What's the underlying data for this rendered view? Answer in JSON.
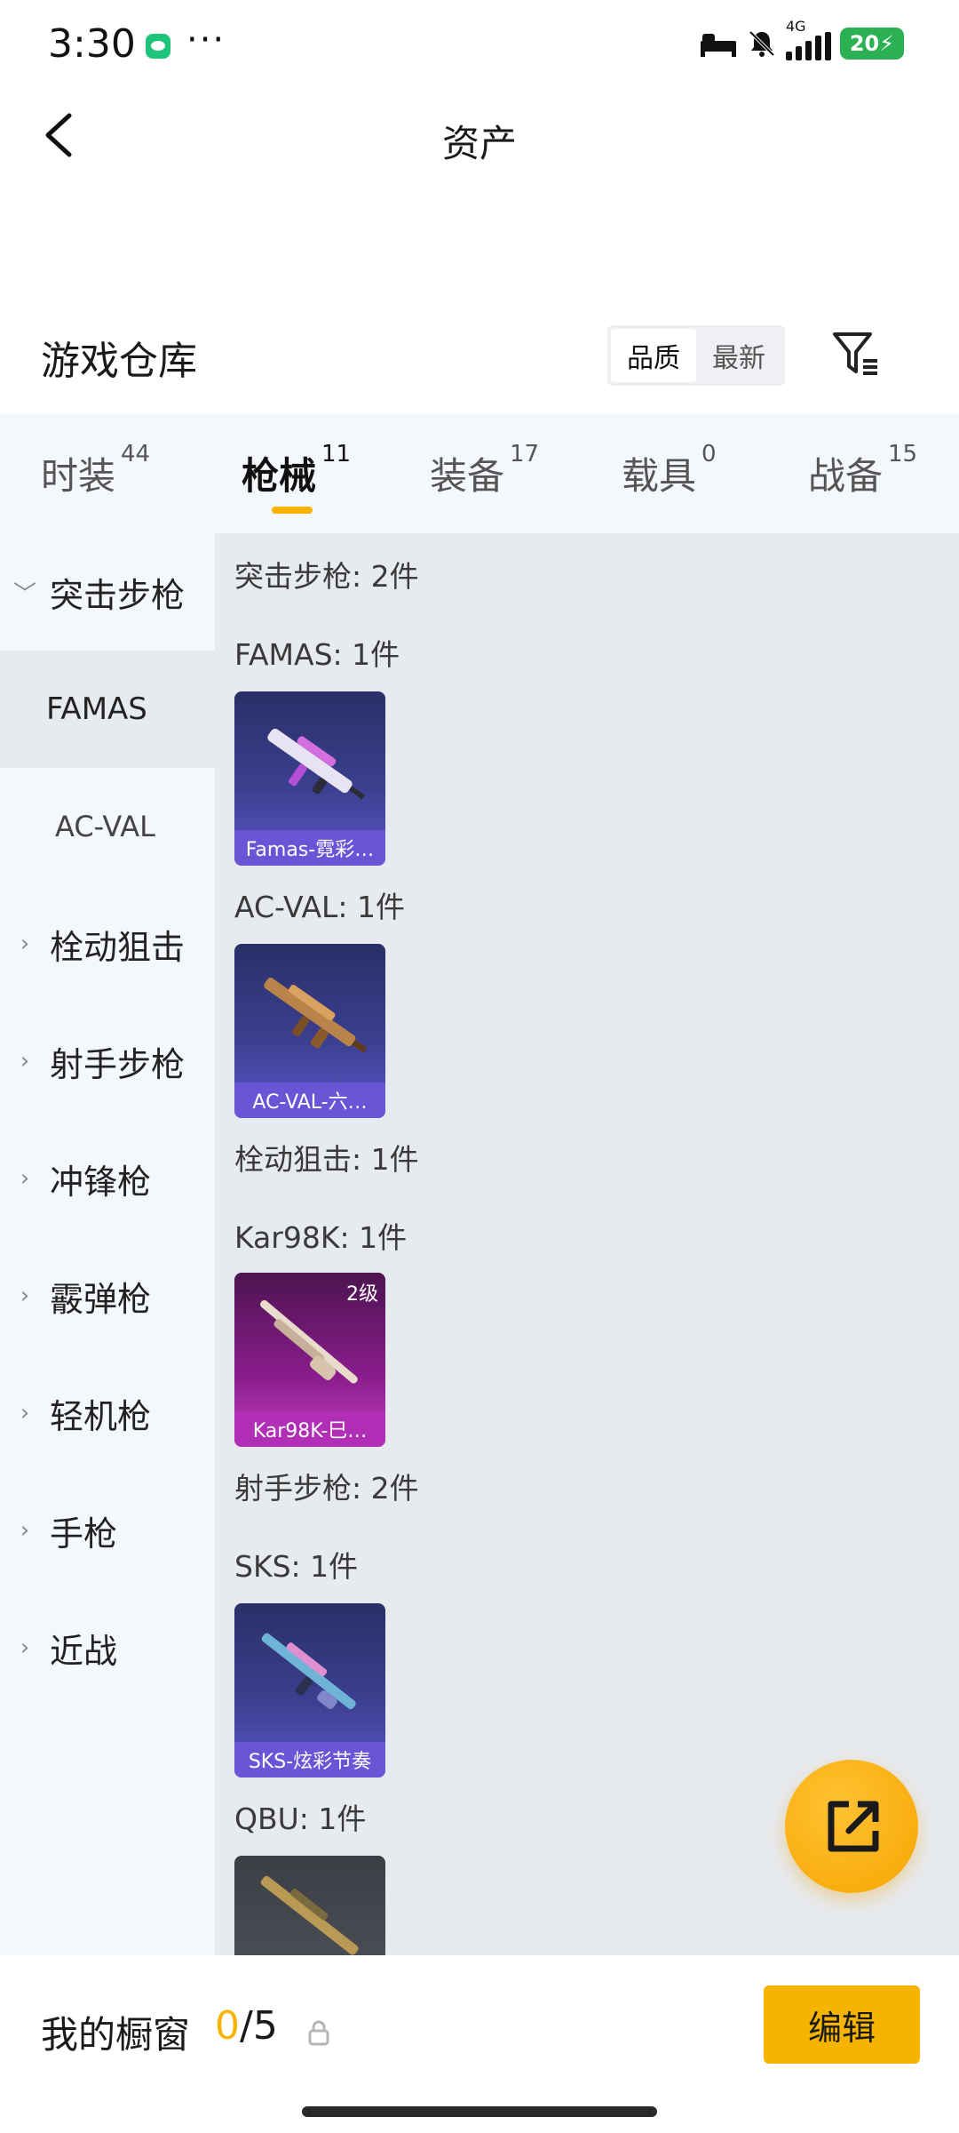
{
  "status_bar": {
    "time": "3:30",
    "dots": "···",
    "network": "4G",
    "battery": "20"
  },
  "nav": {
    "title": "资产"
  },
  "warehouse": {
    "title": "游戏仓库",
    "sort_options": [
      "品质",
      "最新"
    ],
    "selected_sort": "品质"
  },
  "tabs": [
    {
      "label": "时装",
      "count": "44"
    },
    {
      "label": "枪械",
      "count": "11",
      "active": true
    },
    {
      "label": "装备",
      "count": "17"
    },
    {
      "label": "载具",
      "count": "0"
    },
    {
      "label": "战备",
      "count": "15"
    }
  ],
  "sidebar": {
    "items": [
      {
        "label": "突击步枪",
        "expanded": true
      },
      {
        "label": "FAMAS",
        "selected": true
      },
      {
        "label": "AC-VAL"
      },
      {
        "label": "栓动狙击"
      },
      {
        "label": "射手步枪"
      },
      {
        "label": "冲锋枪"
      },
      {
        "label": "霰弹枪"
      },
      {
        "label": "轻机枪"
      },
      {
        "label": "手枪"
      },
      {
        "label": "近战"
      }
    ]
  },
  "content": {
    "sections": [
      {
        "title": "突击步枪: 2件"
      },
      {
        "title": "FAMAS: 1件",
        "card": {
          "caption": "Famas-霓彩…"
        }
      },
      {
        "title": "AC-VAL: 1件",
        "card": {
          "caption": "AC-VAL-六…"
        }
      },
      {
        "title": "栓动狙击: 1件"
      },
      {
        "title": "Kar98K: 1件",
        "card": {
          "caption": "Kar98K-巳…",
          "level": "2级"
        }
      },
      {
        "title": "射手步枪: 2件"
      },
      {
        "title": "SKS: 1件",
        "card": {
          "caption": "SKS-炫彩节奏"
        }
      },
      {
        "title": "QBU: 1件"
      }
    ]
  },
  "showcase": {
    "label": "我的橱窗",
    "current": "0",
    "total": "/5",
    "edit_label": "编辑"
  },
  "colors": {
    "accent": "#f6b400",
    "sidebar_bg": "#f4f7fb",
    "content_bg": "#e7eaee"
  }
}
